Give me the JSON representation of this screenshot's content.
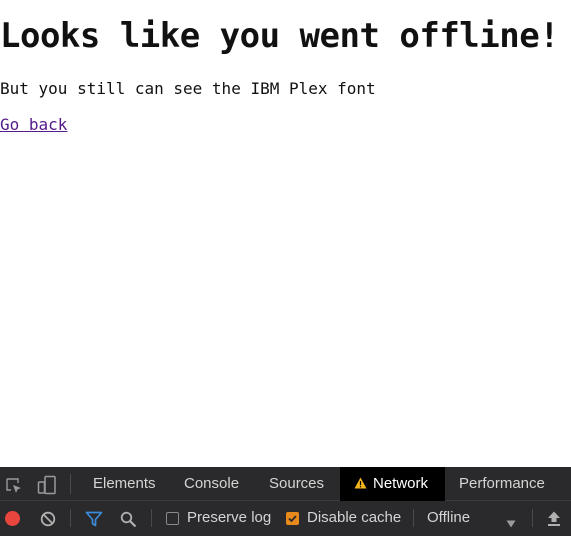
{
  "page": {
    "heading": "Looks like you went offline!",
    "text": "But you still can see the IBM Plex font",
    "link": "Go back"
  },
  "devtools": {
    "tabs": [
      "Elements",
      "Console",
      "Sources",
      "Network",
      "Performance"
    ],
    "active_tab": "Network",
    "preserve_log_label": "Preserve log",
    "preserve_log_checked": false,
    "disable_cache_label": "Disable cache",
    "disable_cache_checked": true,
    "throttle_value": "Offline",
    "colors": {
      "record": "#e8453c",
      "filter": "#3d8bd8",
      "checkbox_accent": "#e8891c",
      "warning": "#f2b51e"
    }
  }
}
